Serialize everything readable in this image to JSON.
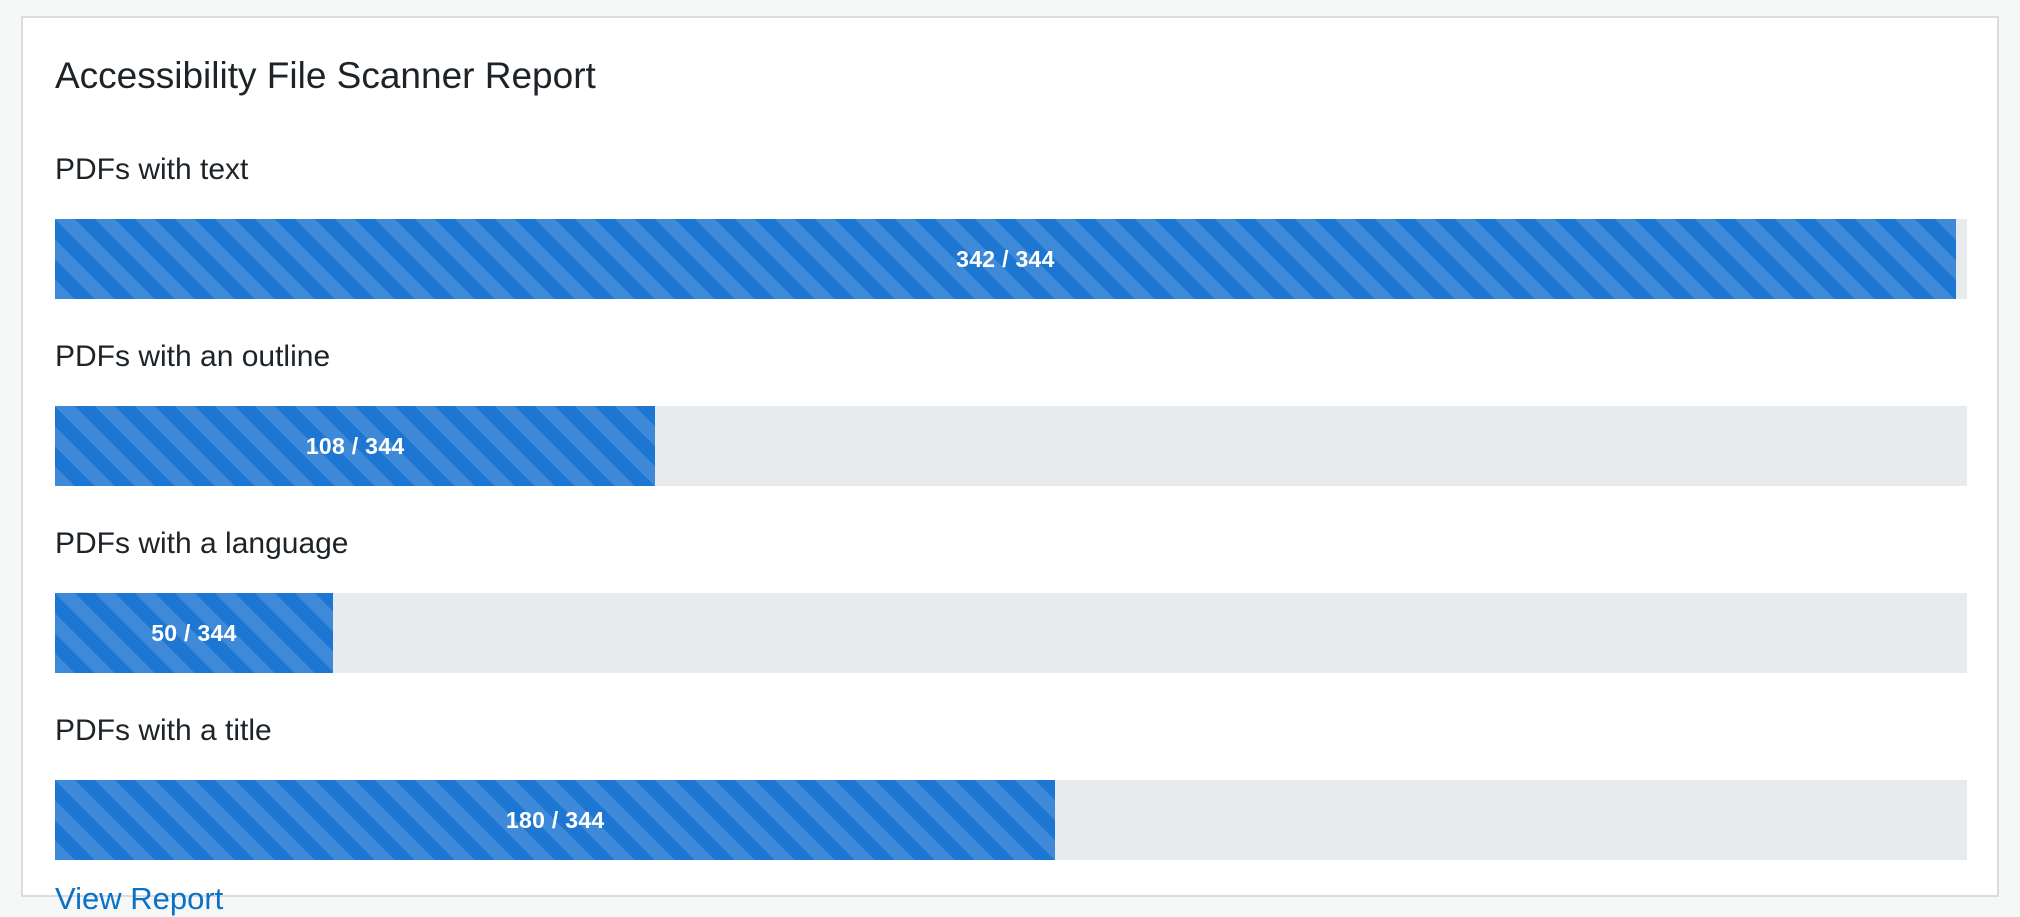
{
  "report": {
    "title": "Accessibility File Scanner Report",
    "link_label": "View Report",
    "colors": {
      "bar": "#1c76d2",
      "track": "#e8ebee",
      "link": "#0a72c6"
    },
    "metrics": [
      {
        "label": "PDFs with text",
        "value": 342,
        "total": 344,
        "display": "342 / 344"
      },
      {
        "label": "PDFs with an outline",
        "value": 108,
        "total": 344,
        "display": "108 / 344"
      },
      {
        "label": "PDFs with a language",
        "value": 50,
        "total": 344,
        "display": "50 / 344"
      },
      {
        "label": "PDFs with a title",
        "value": 180,
        "total": 344,
        "display": "180 / 344"
      }
    ]
  }
}
